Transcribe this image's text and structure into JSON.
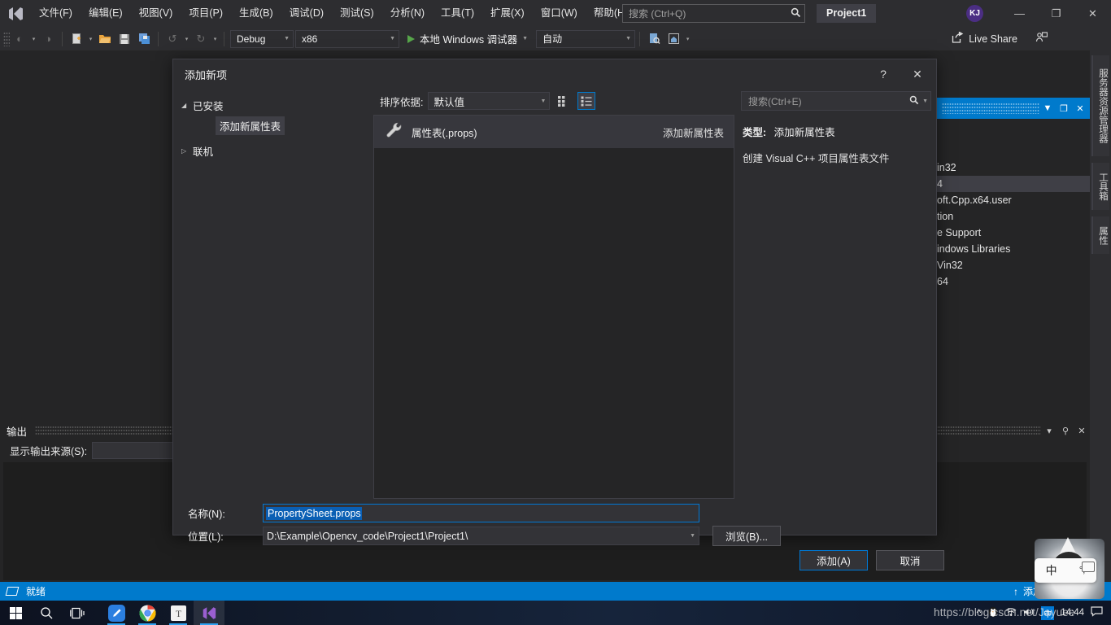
{
  "titlebar": {
    "logo": "vs-logo-icon",
    "menus": [
      {
        "label": "文件(F)"
      },
      {
        "label": "编辑(E)"
      },
      {
        "label": "视图(V)"
      },
      {
        "label": "项目(P)"
      },
      {
        "label": "生成(B)"
      },
      {
        "label": "调试(D)"
      },
      {
        "label": "测试(S)"
      },
      {
        "label": "分析(N)"
      },
      {
        "label": "工具(T)"
      },
      {
        "label": "扩展(X)"
      },
      {
        "label": "窗口(W)"
      },
      {
        "label": "帮助(H)"
      }
    ],
    "search_placeholder": "搜索 (Ctrl+Q)",
    "project_title": "Project1",
    "avatar_initials": "KJ",
    "minimize": "—",
    "restore": "❐",
    "close": "✕"
  },
  "toolbar": {
    "nav_back": "◐",
    "nav_forward": "◑",
    "new_item": "new-item-icon",
    "open_file": "open-file-icon",
    "save": "save-icon",
    "save_all": "save-all-icon",
    "undo": "↺",
    "redo": "↻",
    "config": "Debug",
    "platform": "x86",
    "run_label": "本地 Windows 调试器",
    "auto": "自动",
    "live_share": "Live Share"
  },
  "right_dock": {
    "rows": [
      {
        "label": "in32",
        "selected": false
      },
      {
        "label": "4",
        "selected": true
      },
      {
        "label": "oft.Cpp.x64.user",
        "selected": false
      },
      {
        "label": "tion",
        "selected": false
      },
      {
        "label": "e Support",
        "selected": false
      },
      {
        "label": "indows Libraries",
        "selected": false
      },
      {
        "label": "Vin32",
        "selected": false
      },
      {
        "label": "64",
        "selected": false
      }
    ],
    "dropdown": "▼",
    "maximize": "❐",
    "close": "✕"
  },
  "vertical_tabs": [
    {
      "label": "服务器资源管理器"
    },
    {
      "label": "工具箱"
    },
    {
      "label": "属性"
    }
  ],
  "output": {
    "title": "输出",
    "source_label": "显示输出来源(S):",
    "source_value": "",
    "dropdown_icon": "▾",
    "pin_icon": "⚲",
    "close_icon": "✕"
  },
  "statusbar": {
    "status": "就绪",
    "source_control": "添加到源代码管理",
    "up_arrow": "↑"
  },
  "dialog": {
    "title": "添加新项",
    "help": "?",
    "close": "✕",
    "tree": {
      "installed": {
        "label": "已安装",
        "expanded": true
      },
      "installed_child": "添加新属性表",
      "online": {
        "label": "联机",
        "expanded": false
      }
    },
    "sort_label": "排序依据:",
    "sort_value": "默认值",
    "view_grid_icon": "grid-view-icon",
    "view_list_icon": "list-view-icon",
    "search_placeholder": "搜索(Ctrl+E)",
    "items": [
      {
        "icon": "wrench-icon",
        "name": "属性表(.props)",
        "category": "添加新属性表",
        "selected": true
      }
    ],
    "details": {
      "type_label": "类型:",
      "type_value": "添加新属性表",
      "description": "创建 Visual C++ 项目属性表文件"
    },
    "name_label": "名称(N):",
    "name_value": "PropertySheet.props",
    "location_label": "位置(L):",
    "location_value": "D:\\Example\\Opencv_code\\Project1\\Project1\\",
    "browse_button": "浏览(B)...",
    "add_button": "添加(A)",
    "cancel_button": "取消"
  },
  "taskbar": {
    "start": "start-icon",
    "search": "search-icon",
    "taskview": "task-view-icon",
    "apps": [
      {
        "name": "blue-editor-app-icon",
        "glyph": "✎"
      },
      {
        "name": "chrome-icon",
        "glyph": "◉"
      },
      {
        "name": "text-app-icon",
        "glyph": "T"
      },
      {
        "name": "visual-studio-icon",
        "glyph": "✕"
      }
    ],
    "tray_expand": "^",
    "qq_icon": "qq-penguin-icon",
    "network_icon": "network-icon",
    "volume_icon": "volume-icon",
    "ime_indicator": "中",
    "clock": "14:44",
    "action_center": "notification-icon"
  },
  "ime": {
    "mode": "中",
    "punctuation": "°,"
  },
  "watermark": "https://blog.csdn.net/Jayuee"
}
